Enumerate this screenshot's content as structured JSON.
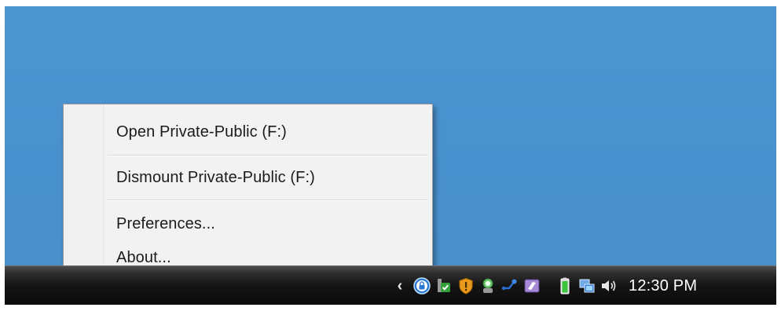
{
  "context_menu": {
    "items": [
      {
        "label": "Open Private-Public (F:)"
      },
      {
        "label": "Dismount Private-Public (F:)"
      },
      {
        "label": "Preferences..."
      },
      {
        "label": "About..."
      }
    ]
  },
  "taskbar": {
    "tray_icons": [
      "show-hidden-icons-chevron",
      "lock-app-icon",
      "security-center-icon",
      "shield-alert-icon",
      "network-people-icon",
      "bluetooth-icon",
      "pen-input-icon",
      "battery-icon",
      "network-icon",
      "volume-icon"
    ],
    "clock": "12:30 PM"
  },
  "colors": {
    "desktop": "#4a93cf",
    "menu_bg": "#f2f2f2",
    "taskbar": "#141414"
  }
}
